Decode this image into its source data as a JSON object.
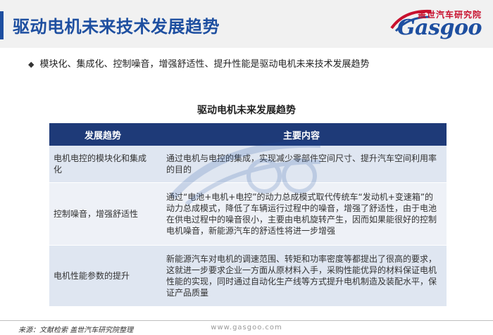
{
  "header": {
    "title": "驱动电机未来技术发展趋势",
    "logo_cn": "盖世汽车研究院",
    "logo_en": "Gasgoo"
  },
  "bullet": "模块化、集成化、控制噪音，增强舒适性、提升性能是驱动电机未来技术发展趋势",
  "table": {
    "title": "驱动电机未来发展趋势",
    "headers": [
      "发展趋势",
      "主要内容"
    ],
    "rows": [
      {
        "trend": "电机电控的模块化和集成化",
        "content": "通过电机与电控的集成，实现减少零部件空间尺寸、提升汽车空间利用率的目的"
      },
      {
        "trend": "控制噪音，增强舒适性",
        "content": "通过“电池+电机+电控”的动力总成模式取代传统车“发动机+变速箱”的动力总成模式，降低了车辆运行过程中的噪音，增强了舒适性，由于电池在供电过程中的噪音很小，主要由电机旋转产生，因而如果能很好的控制电机噪音，新能源汽车的舒适性将进一步增强"
      },
      {
        "trend": "电机性能参数的提升",
        "content": "新能源汽车对电机的调速范围、转矩和功率密度等都提出了很高的要求，这就进一步要求企业一方面从原材料入手，采购性能优异的材料保证电机性能的实现，同时通过自动化生产线等方式提升电机制造及装配水平，保证产品质量"
      }
    ]
  },
  "footer": {
    "source": "来源：文献检索  盖世汽车研究院整理",
    "url": "www.gasgoo.com"
  }
}
